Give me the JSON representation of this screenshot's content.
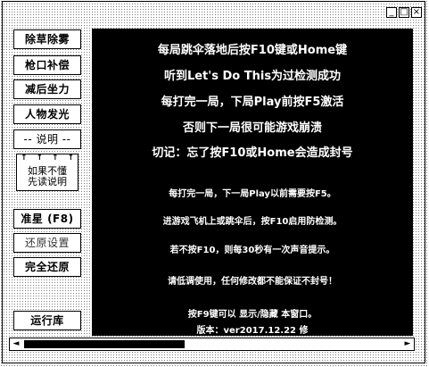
{
  "window_buttons": [
    "_",
    "□",
    "×"
  ],
  "sidebar": {
    "buttons": [
      {
        "label": "除草除雾"
      },
      {
        "label": "枪口补偿"
      },
      {
        "label": "减后坐力"
      },
      {
        "label": "人物发光"
      },
      {
        "label": "-- 说明 --"
      }
    ],
    "notice": {
      "arrows": "↑↑↑↑",
      "text": "如果不懂\n先读说明"
    },
    "buttons2": [
      {
        "label": "准星 (F8)"
      },
      {
        "label": "还原设置"
      },
      {
        "label": "完全还原"
      }
    ],
    "run_label": "运行库"
  },
  "panel": {
    "big_lines": [
      "每局跳伞落地后按F10键或Home键",
      "听到Let's Do This为过检测成功",
      "每打完一局，下局Play前按F5激活",
      "否则下一局很可能游戏崩溃",
      "切记：忘了按F10或Home会造成封号"
    ],
    "small_lines": [
      "每打完一局，下一局Play以前需要按F5。",
      "进游戏飞机上或跳伞后，按F10启用防检测。",
      "若不按F10，则每30秒有一次声音提示。",
      "请低调使用，任何修改都不能保证不封号！",
      "按F9键可以 显示/隐藏 本窗口。",
      "版本：ver2017.12.22 修"
    ]
  },
  "scrollbar": {
    "left_arrow": "◄",
    "right_arrow": "►",
    "position": 0.4
  }
}
